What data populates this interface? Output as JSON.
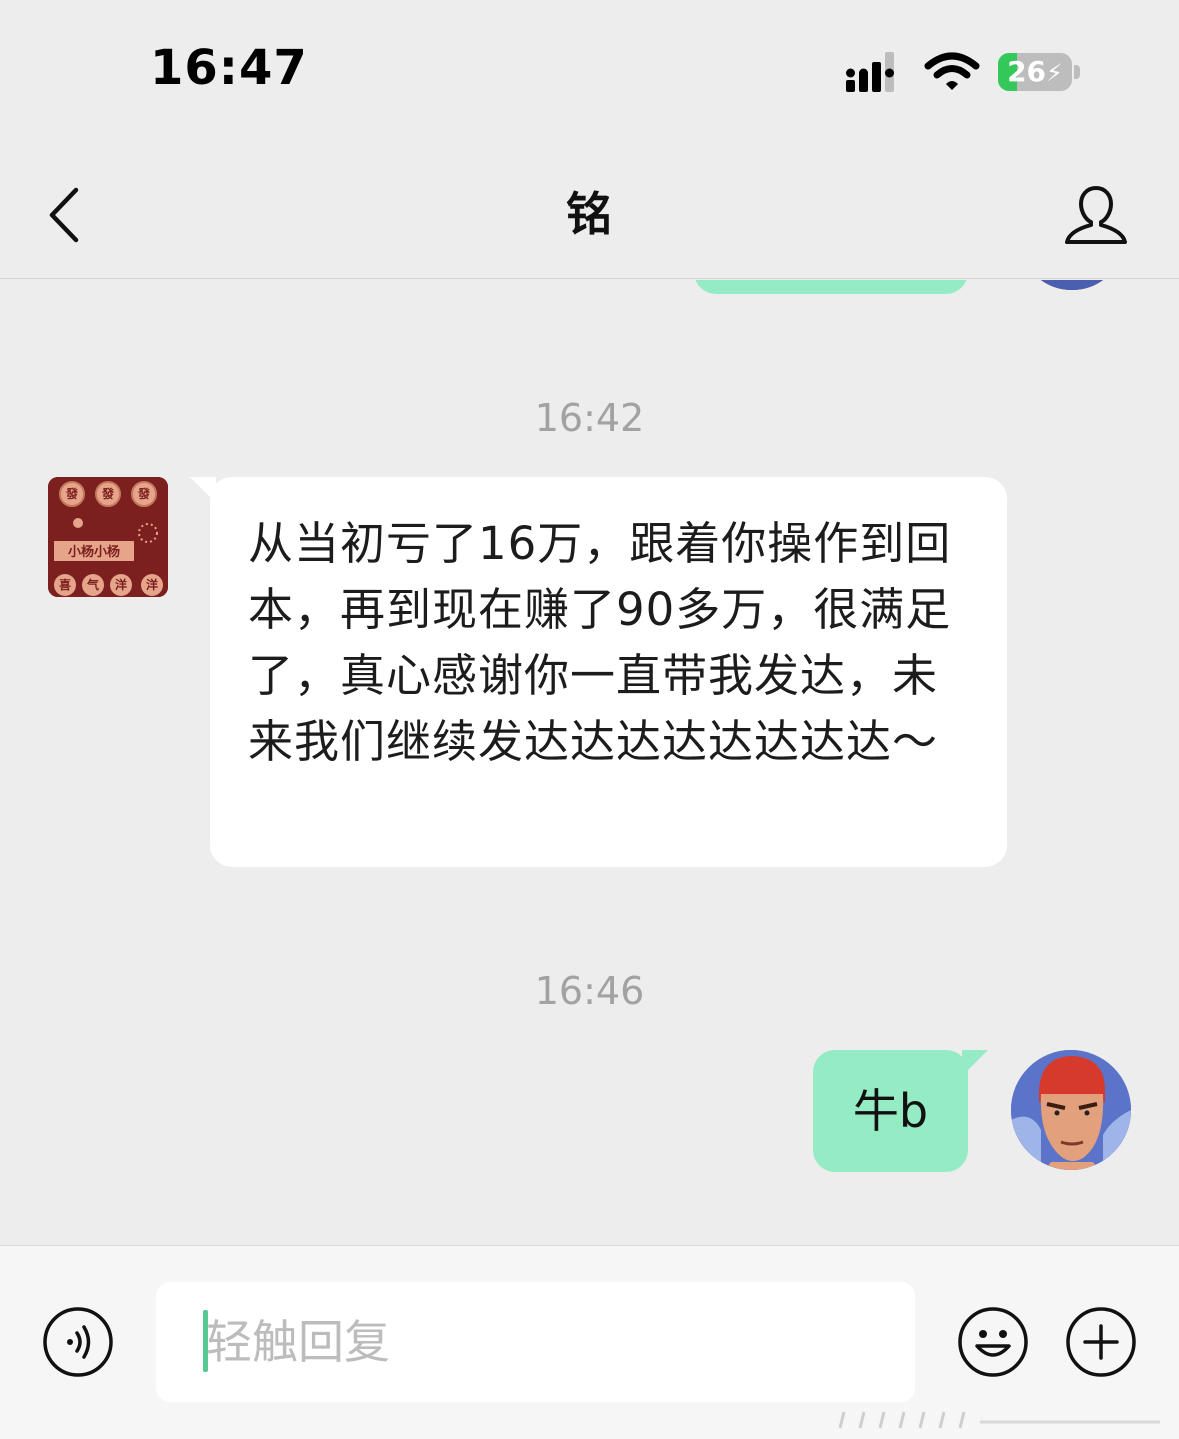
{
  "status_bar": {
    "time": "16:47",
    "battery_level": "26",
    "battery_fraction": 0.26,
    "signal_icon": "cellular-signal-icon",
    "wifi_icon": "wifi-icon",
    "charging_icon": "bolt-icon"
  },
  "header": {
    "title": "铭",
    "back_icon": "chevron-left-icon",
    "profile_icon": "person-icon"
  },
  "messages": [
    {
      "type": "timestamp",
      "text": "16:42"
    },
    {
      "type": "received",
      "text": "从当初亏了16万，跟着你操作到回本，再到现在赚了90多万，很满足了，真心感谢你一直带我发达，未来我们继续发达达达达达达达达～"
    },
    {
      "type": "timestamp",
      "text": "16:46"
    },
    {
      "type": "sent",
      "text": "牛b"
    }
  ],
  "avatar_left": {
    "logo_text": [
      "發",
      "發",
      "發",
      "小杨小杨",
      "喜",
      "气",
      "洋",
      "洋"
    ]
  },
  "input_bar": {
    "placeholder": "轻触回复",
    "voice_icon": "voice-icon",
    "emoji_icon": "emoji-icon",
    "plus_icon": "plus-icon"
  },
  "colors": {
    "background": "#ededed",
    "sent_bubble": "#95ecc4",
    "received_bubble": "#ffffff",
    "accent": "#56c994",
    "battery_green": "#34c759",
    "timestamp": "#a2a2a2"
  }
}
